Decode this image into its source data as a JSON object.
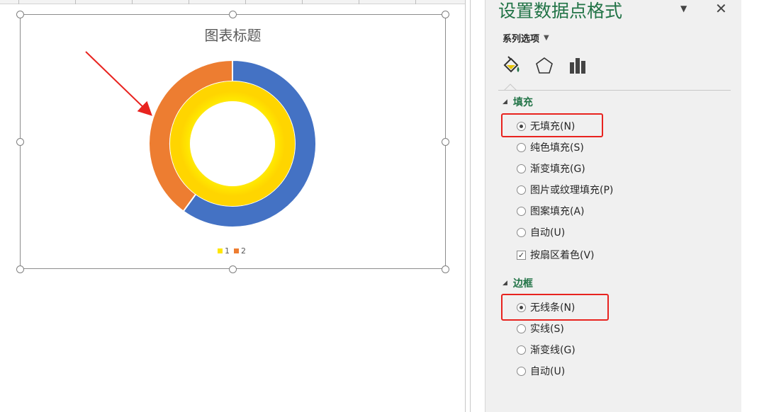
{
  "chart": {
    "title": "图表标题",
    "legend": [
      {
        "label": "1",
        "color": "#ffe600"
      },
      {
        "label": "2",
        "color": "#ed7d31"
      }
    ]
  },
  "chart_data": {
    "type": "pie",
    "subtype": "doughnut",
    "title": "图表标题",
    "rings": [
      {
        "ring": "inner",
        "slices": [
          {
            "label": "1",
            "value": 100,
            "color": "#ffe600"
          }
        ]
      },
      {
        "ring": "outer",
        "slices": [
          {
            "label": "1",
            "value": 60,
            "color": "#4472c4"
          },
          {
            "label": "2",
            "value": 40,
            "color": "#ed7d31"
          }
        ]
      }
    ],
    "legend_position": "bottom"
  },
  "pane": {
    "title": "设置数据点格式",
    "series_dropdown": "系列选项",
    "tabs": [
      "fill-line-icon",
      "effects-icon",
      "series-options-icon"
    ],
    "fill_section": {
      "label": "填充",
      "options": [
        {
          "label": "无填充(N)",
          "selected": true
        },
        {
          "label": "纯色填充(S)",
          "selected": false
        },
        {
          "label": "渐变填充(G)",
          "selected": false
        },
        {
          "label": "图片或纹理填充(P)",
          "selected": false
        },
        {
          "label": "图案填充(A)",
          "selected": false
        },
        {
          "label": "自动(U)",
          "selected": false
        }
      ],
      "vary_by_slice": {
        "label": "按扇区着色(V)",
        "checked": true
      }
    },
    "border_section": {
      "label": "边框",
      "options": [
        {
          "label": "无线条(N)",
          "selected": true
        },
        {
          "label": "实线(S)",
          "selected": false
        },
        {
          "label": "渐变线(G)",
          "selected": false
        },
        {
          "label": "自动(U)",
          "selected": false
        }
      ]
    }
  },
  "colors": {
    "accent_green": "#217346",
    "highlight_red": "#e8231f",
    "annotation_arrow": "#e8231f"
  }
}
